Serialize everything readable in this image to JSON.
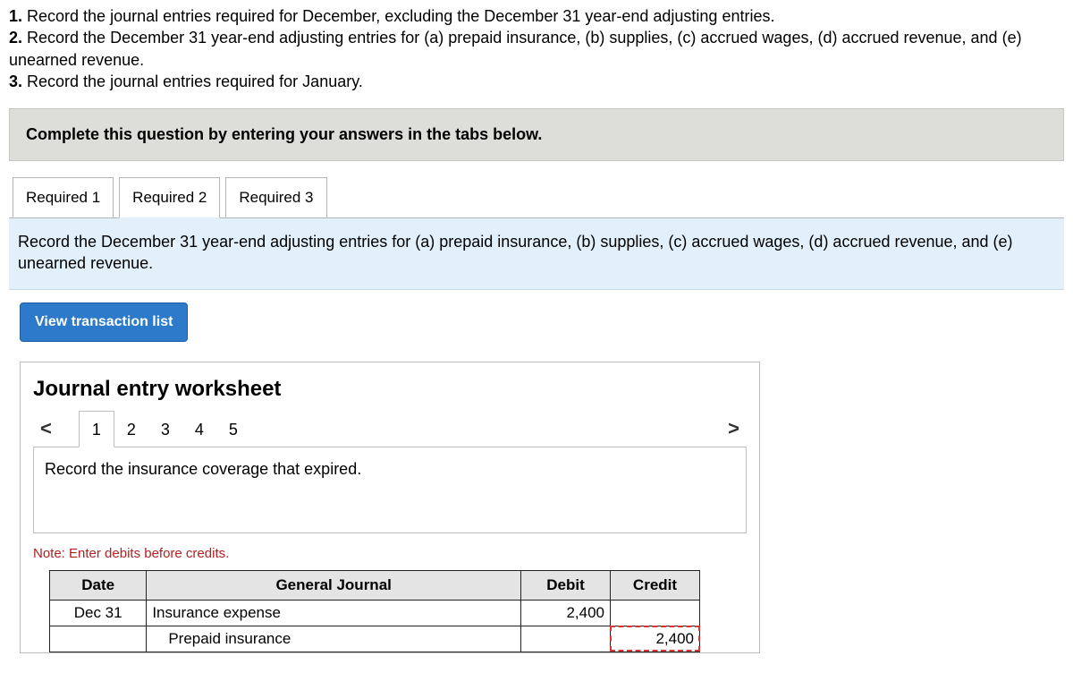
{
  "instructions": {
    "n1": "1.",
    "t1": " Record the journal entries required for December, excluding the December 31 year-end adjusting entries.",
    "n2": "2.",
    "t2": " Record the December 31 year-end adjusting entries for (a) prepaid insurance, (b) supplies, (c) accrued wages, (d) accrued revenue, and (e) unearned revenue.",
    "n3": "3.",
    "t3": " Record the journal entries required for January."
  },
  "banner": "Complete this question by entering your answers in the tabs below.",
  "tabs": {
    "r1": "Required 1",
    "r2": "Required 2",
    "r3": "Required 3"
  },
  "panel_text": "Record the December 31 year-end adjusting entries for (a) prepaid insurance, (b) supplies, (c) accrued wages, (d) accrued revenue, and (e) unearned revenue.",
  "view_btn": "View transaction list",
  "ws": {
    "title": "Journal entry worksheet",
    "je_tabs": {
      "t1": "1",
      "t2": "2",
      "t3": "3",
      "t4": "4",
      "t5": "5"
    },
    "arrow_left": "<",
    "arrow_right": ">",
    "description": "Record the insurance coverage that expired.",
    "note": "Note: Enter debits before credits.",
    "headers": {
      "date": "Date",
      "gj": "General Journal",
      "debit": "Debit",
      "credit": "Credit"
    },
    "rows": {
      "r1": {
        "date": "Dec 31",
        "gj": "Insurance expense",
        "debit": "2,400",
        "credit": ""
      },
      "r2": {
        "date": "",
        "gj": "Prepaid insurance",
        "debit": "",
        "credit": "2,400"
      }
    }
  }
}
